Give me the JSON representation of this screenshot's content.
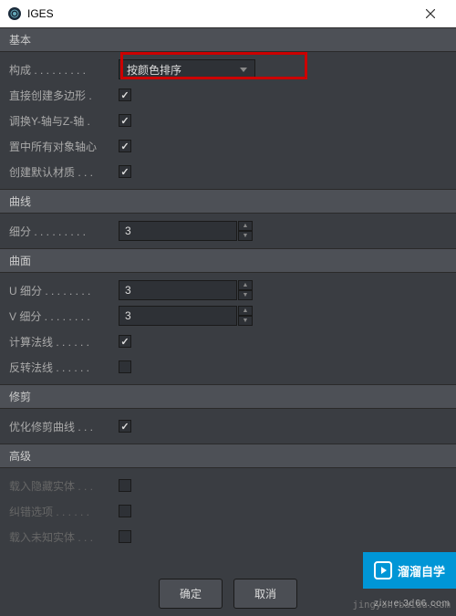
{
  "window": {
    "title": "IGES"
  },
  "sections": {
    "basic": {
      "header": "基本",
      "composition_label": "构成 . . . . . . . . .",
      "composition_value": "按颜色排序",
      "direct_polygons_label": "直接创建多边形 .",
      "swap_yz_label": "调换Y-轴与Z-轴 .",
      "center_axis_label": "置中所有对象轴心",
      "create_material_label": "创建默认材质 . . .",
      "direct_polygons": true,
      "swap_yz": true,
      "center_axis": true,
      "create_material": true
    },
    "curves": {
      "header": "曲线",
      "subdiv_label": "细分 . . . . . . . . .",
      "subdiv_value": "3"
    },
    "surfaces": {
      "header": "曲面",
      "u_subdiv_label": "U 细分 . . . . . . . .",
      "u_subdiv_value": "3",
      "v_subdiv_label": "V 细分 . . . . . . . .",
      "v_subdiv_value": "3",
      "calc_normals_label": "计算法线 . . . . . .",
      "calc_normals": true,
      "flip_normals_label": "反转法线 . . . . . .",
      "flip_normals": false
    },
    "trim": {
      "header": "修剪",
      "optimize_label": "优化修剪曲线 . . .",
      "optimize": true
    },
    "advanced": {
      "header": "高级",
      "hidden_entities_label": "载入隐藏实体 . . .",
      "hidden_entities": false,
      "error_options_label": "纠错选项 . . . . . .",
      "error_options": false,
      "unknown_entities_label": "载入未知实体 . . .",
      "unknown_entities": false
    }
  },
  "buttons": {
    "ok": "确定",
    "cancel": "取消"
  },
  "watermark": {
    "brand": "溜溜自学",
    "sub": "zixue.3d66.com",
    "url": "jingyan.baidu.com"
  }
}
